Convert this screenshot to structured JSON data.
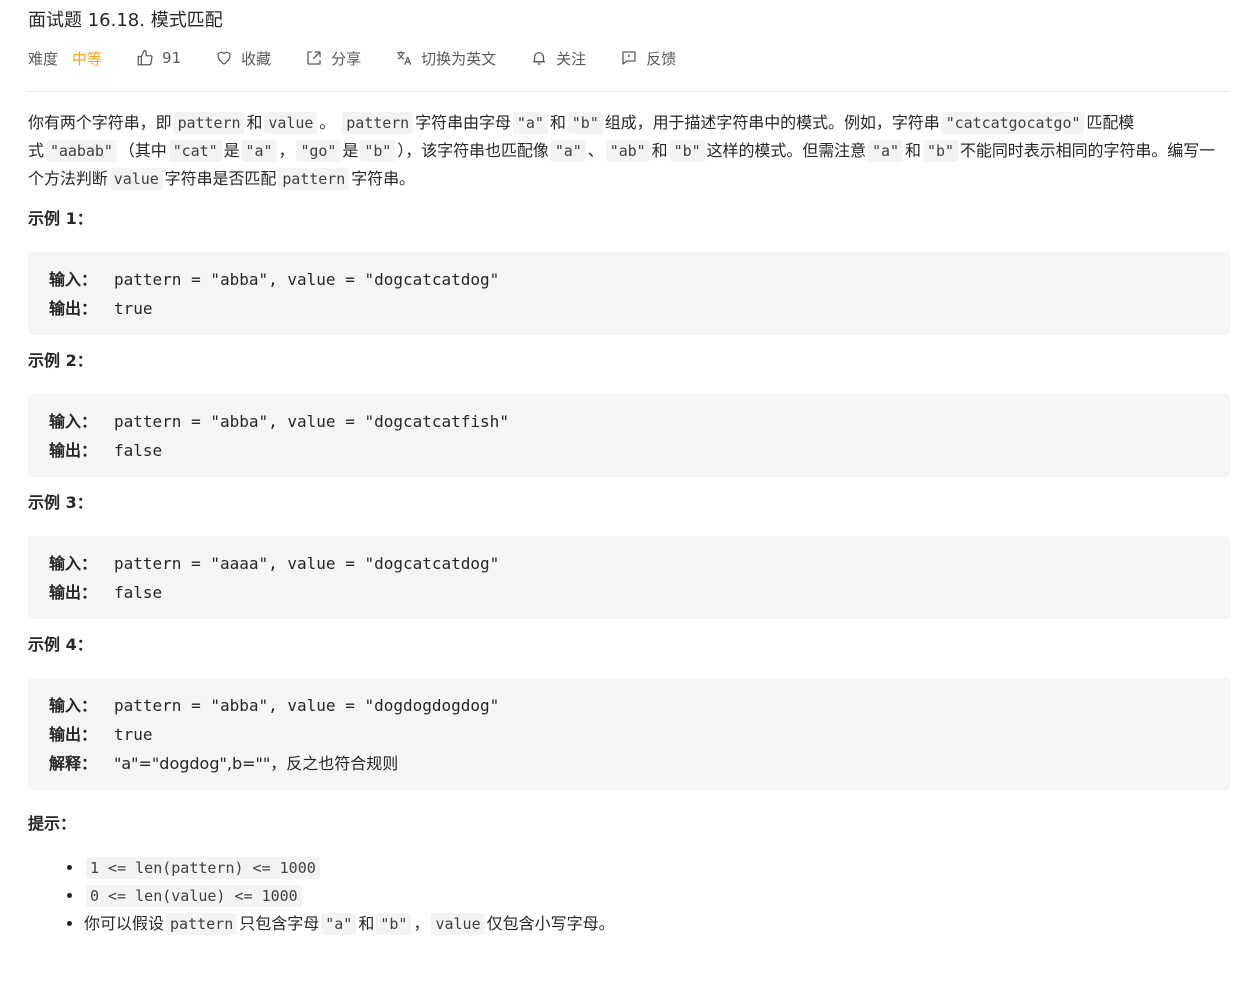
{
  "header": {
    "title": "面试题 16.18. 模式匹配",
    "difficulty_label": "难度",
    "difficulty_value": "中等",
    "difficulty_color": "#ffa116",
    "like_count": "91",
    "favorite_label": "收藏",
    "share_label": "分享",
    "translate_label": "切换为英文",
    "follow_label": "关注",
    "feedback_label": "反馈"
  },
  "description": {
    "p1_a": "你有两个字符串，即",
    "code_pattern": "pattern",
    "p1_b": "和",
    "code_value": "value",
    "p1_c": "。",
    "p1_d": "字符串由字母",
    "code_a": "\"a\"",
    "p1_e": "和",
    "code_b": "\"b\"",
    "p1_f": "组成，用于描述字符串中的模式。例如，字符串",
    "code_example_str": "\"catcatgocatgo\"",
    "p1_g": "匹配模式",
    "code_example_pattern": "\"aabab\"",
    "p1_h": "（其中",
    "code_cat": "\"cat\"",
    "p1_i": "是",
    "p1_j": "，",
    "code_go": "\"go\"",
    "p1_k": "是",
    "p1_l": "），该字符串也匹配像",
    "p1_m": "、",
    "code_ab": "\"ab\"",
    "p1_n": "和",
    "p1_o": "这样的模式。但需注意",
    "p1_p": "和",
    "p1_q": "不能同时表示相同的字符串。编写一个方法判断",
    "p1_r": "字符串是否匹配",
    "p1_s": "字符串。"
  },
  "examples": [
    {
      "title": "示例 1：",
      "input_label": "输入：",
      "input": "pattern = \"abba\", value = \"dogcatcatdog\"",
      "output_label": "输出：",
      "output": "true"
    },
    {
      "title": "示例 2：",
      "input_label": "输入：",
      "input": "pattern = \"abba\", value = \"dogcatcatfish\"",
      "output_label": "输出：",
      "output": "false"
    },
    {
      "title": "示例 3：",
      "input_label": "输入：",
      "input": "pattern = \"aaaa\", value = \"dogcatcatdog\"",
      "output_label": "输出：",
      "output": "false"
    },
    {
      "title": "示例 4：",
      "input_label": "输入：",
      "input": "pattern = \"abba\", value = \"dogdogdogdog\"",
      "output_label": "输出：",
      "output": "true",
      "explain_label": "解释：",
      "explain": "\"a\"=\"dogdog\",b=\"\"，反之也符合规则"
    }
  ],
  "hints": {
    "title": "提示：",
    "h1_code": "1 <= len(pattern) <= 1000",
    "h2_code": "0 <= len(value) <= 1000",
    "h3_a": "你可以假设",
    "h3_b": "只包含字母",
    "h3_c": "和",
    "h3_d": "，",
    "h3_e": "仅包含小写字母。"
  }
}
